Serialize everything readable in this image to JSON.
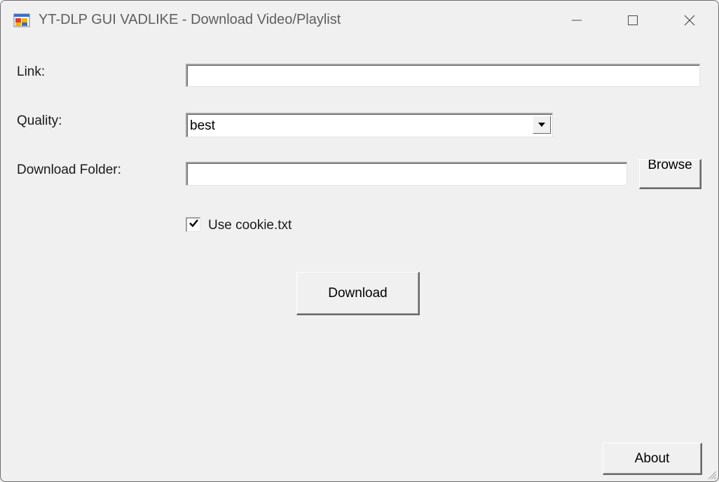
{
  "window": {
    "title": "YT-DLP GUI VADLIKE - Download Video/Playlist",
    "icon": "app-window-icon",
    "controls": [
      "minimize-icon",
      "maximize-icon",
      "close-icon"
    ]
  },
  "form": {
    "link_label": "Link:",
    "link_value": "",
    "quality_label": "Quality:",
    "quality_selected": "best",
    "folder_label": "Download Folder:",
    "folder_value": "",
    "browse_label": "Browse",
    "cookie_label": "Use cookie.txt",
    "cookie_checked": true,
    "download_label": "Download",
    "about_label": "About"
  }
}
